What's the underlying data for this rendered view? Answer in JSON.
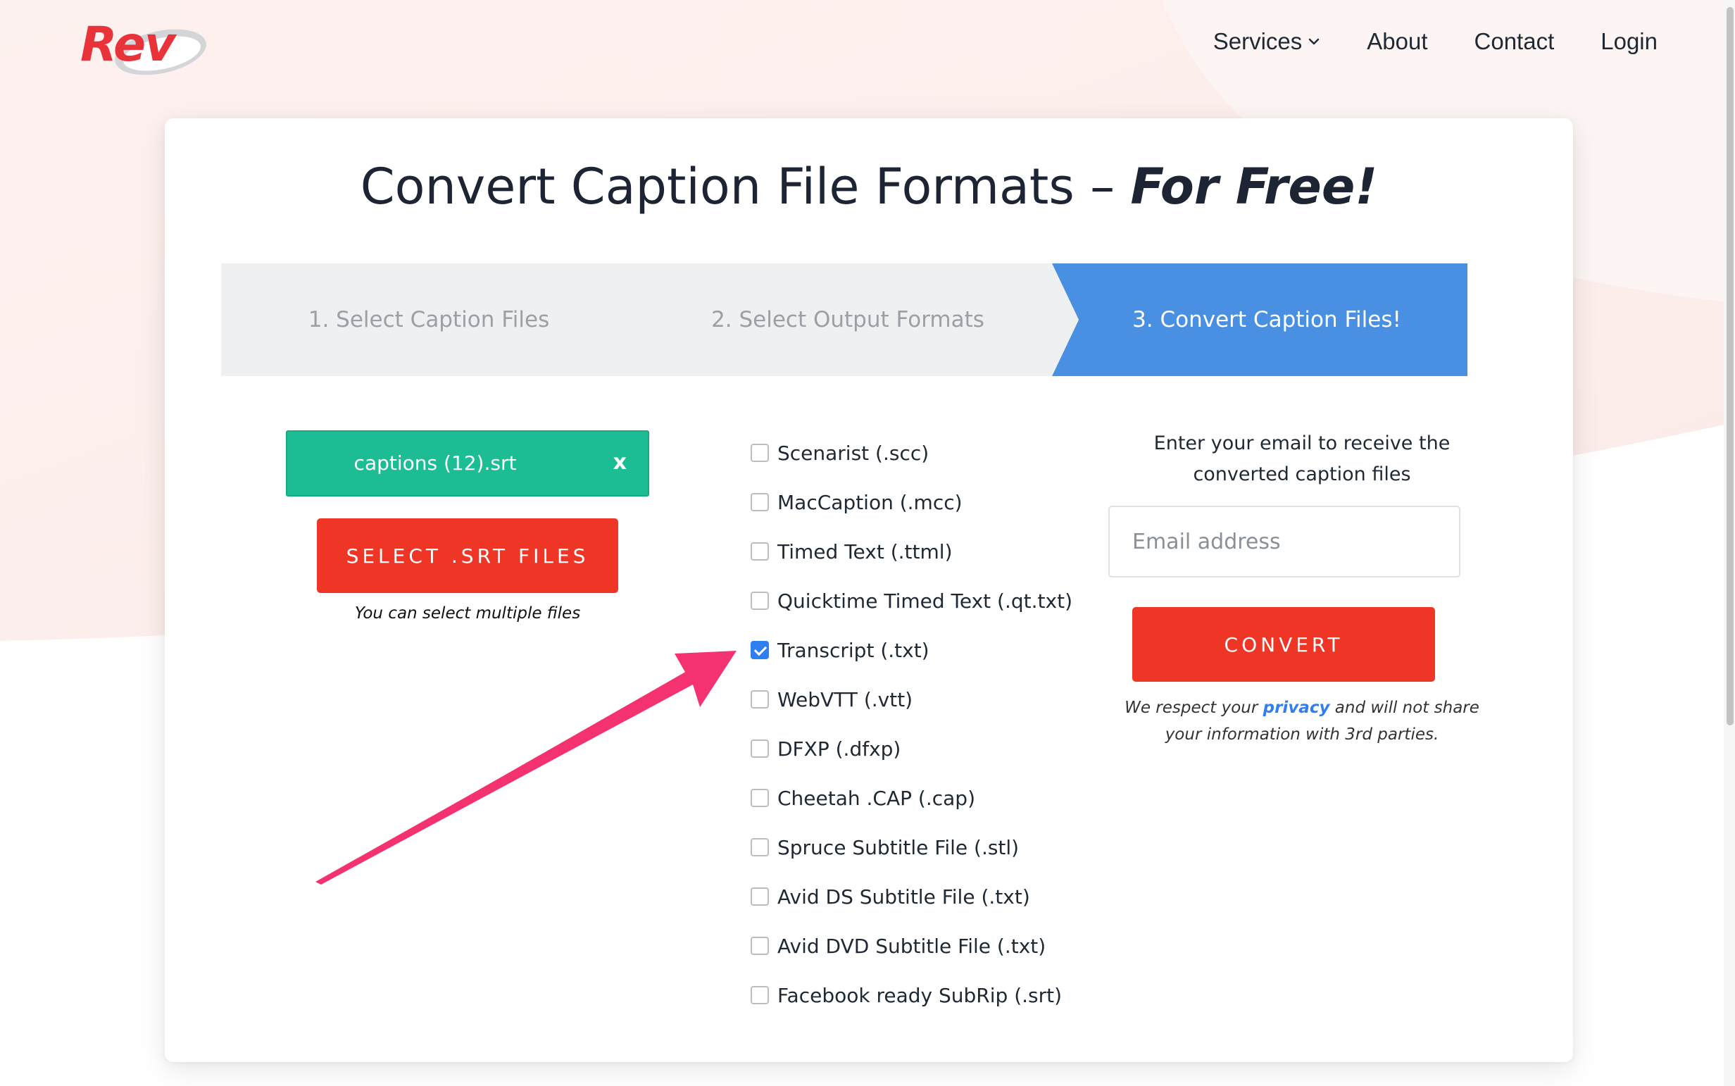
{
  "brand": {
    "logo_text": "Rev",
    "primary_color": "#e8333a",
    "accent_blue": "#4a90e2",
    "accent_green": "#1cbc94"
  },
  "nav": {
    "services": "Services",
    "about": "About",
    "contact": "Contact",
    "login": "Login"
  },
  "page": {
    "title_main": "Convert Caption File Formats –",
    "title_emphasis": "For Free!"
  },
  "steps": [
    {
      "label": "1. Select Caption Files",
      "active": false
    },
    {
      "label": "2. Select Output Formats",
      "active": false
    },
    {
      "label": "3. Convert Caption Files!",
      "active": true
    }
  ],
  "upload": {
    "file_name": "captions (12).srt",
    "remove_label": "x",
    "select_button": "SELECT .SRT FILES",
    "hint": "You can select multiple files"
  },
  "formats": [
    {
      "label": "Scenarist (.scc)",
      "checked": false
    },
    {
      "label": "MacCaption (.mcc)",
      "checked": false
    },
    {
      "label": "Timed Text (.ttml)",
      "checked": false
    },
    {
      "label": "Quicktime Timed Text (.qt.txt)",
      "checked": false
    },
    {
      "label": "Transcript (.txt)",
      "checked": true
    },
    {
      "label": "WebVTT (.vtt)",
      "checked": false
    },
    {
      "label": "DFXP (.dfxp)",
      "checked": false
    },
    {
      "label": "Cheetah .CAP (.cap)",
      "checked": false
    },
    {
      "label": "Spruce Subtitle File (.stl)",
      "checked": false
    },
    {
      "label": "Avid DS Subtitle File (.txt)",
      "checked": false
    },
    {
      "label": "Avid DVD Subtitle File (.txt)",
      "checked": false
    },
    {
      "label": "Facebook ready SubRip (.srt)",
      "checked": false
    }
  ],
  "email": {
    "prompt": "Enter your email to receive the converted caption files",
    "placeholder": "Email address",
    "value": ""
  },
  "convert": {
    "button": "CONVERT",
    "note_before": "We respect your",
    "note_link": "privacy",
    "note_after": "and will not share your information with 3rd parties."
  },
  "annotation": {
    "arrow_color": "#f4326f"
  }
}
